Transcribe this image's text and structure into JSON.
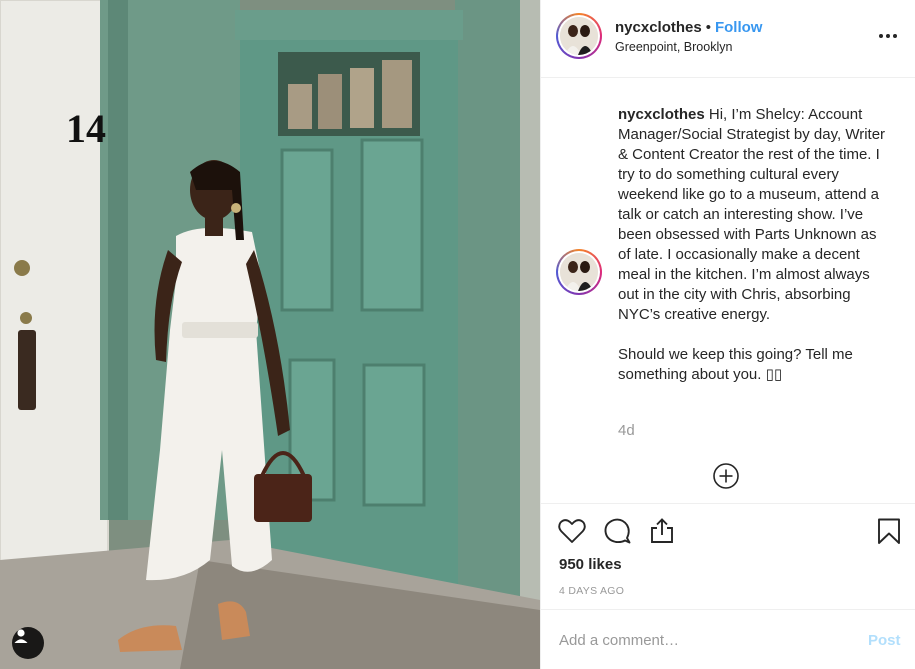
{
  "post": {
    "username": "nycxclothes",
    "separator": "•",
    "follow_label": "Follow",
    "location": "Greenpoint, Brooklyn",
    "door_number": "14"
  },
  "caption": {
    "username": "nycxclothes",
    "text_paragraph_1": "Hi, I’m Shelcy: Account Manager/Social Strategist by day, Writer & Content Creator the rest of the time. I try to do something cultural every weekend like go to a museum, attend a talk or catch an interesting show. I’ve been obsessed with Parts Unknown as of late. I occasionally make a decent meal in the kitchen. I’m almost always out in the city with Chris, absorbing NYC’s creative energy.",
    "text_paragraph_2": "Should we keep this going? Tell me something about you. ▯▯",
    "age": "4d"
  },
  "engagement": {
    "likes": "950 likes",
    "posted": "4 DAYS AGO"
  },
  "comment": {
    "placeholder": "Add a comment…",
    "post_label": "Post"
  },
  "icons": {
    "more": "more-options-icon",
    "load_more": "plus-circle-icon",
    "like": "heart-icon",
    "comment": "comment-bubble-icon",
    "share": "share-icon",
    "save": "bookmark-icon",
    "user_tag": "user-tag-icon"
  },
  "colors": {
    "accent_blue": "#3897f0",
    "post_disabled": "#b2dffc",
    "door_green": "#5f9886",
    "muted_text": "#999999"
  }
}
